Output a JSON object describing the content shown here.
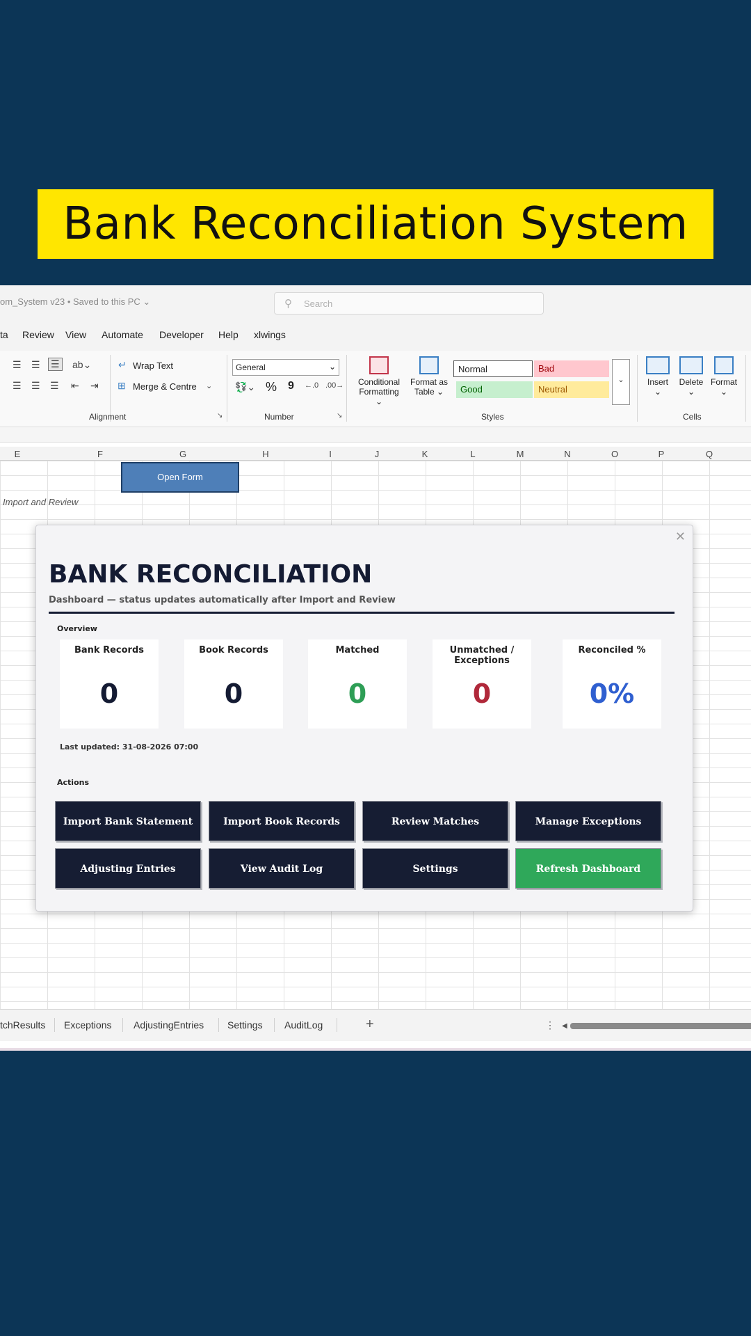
{
  "banner": {
    "title": "Bank Reconciliation System"
  },
  "excel": {
    "doc_title": "om_System v23 • Saved to this PC ⌄",
    "search_placeholder": "Search",
    "menu": [
      "ta",
      "Review",
      "View",
      "Automate",
      "Developer",
      "Help",
      "xlwings"
    ],
    "ribbon": {
      "wrap_text": "Wrap Text",
      "merge_centre": "Merge & Centre",
      "alignment_label": "Alignment",
      "number_format": "General",
      "number_label": "Number",
      "percent": "%",
      "comma": "9",
      "conditional_formatting_1": "Conditional",
      "conditional_formatting_2": "Formatting ⌄",
      "format_as_table_1": "Format as",
      "format_as_table_2": "Table ⌄",
      "styles": {
        "normal": "Normal",
        "bad": "Bad",
        "good": "Good",
        "neutral": "Neutral"
      },
      "styles_label": "Styles",
      "insert": "Insert",
      "delete": "Delete",
      "format": "Format",
      "cells_label": "Cells"
    },
    "columns": [
      "E",
      "F",
      "G",
      "H",
      "I",
      "J",
      "K",
      "L",
      "M",
      "N",
      "O",
      "P",
      "Q"
    ],
    "open_form": "Open Form",
    "import_note": "Import and Review",
    "sheet_tabs": [
      "tchResults",
      "Exceptions",
      "AdjustingEntries",
      "Settings",
      "AuditLog"
    ]
  },
  "dialog": {
    "title": "BANK RECONCILIATION",
    "subtitle": "Dashboard — status updates automatically after Import and Review",
    "overview_label": "Overview",
    "cards": [
      {
        "label": "Bank Records",
        "value": "0",
        "color": "#141b33"
      },
      {
        "label": "Book Records",
        "value": "0",
        "color": "#141b33"
      },
      {
        "label": "Matched",
        "value": "0",
        "color": "#2e9e56"
      },
      {
        "label": "Unmatched / Exceptions",
        "value": "0",
        "color": "#b0283a"
      },
      {
        "label": "Reconciled %",
        "value": "0%",
        "color": "#2f5fd0"
      }
    ],
    "last_updated": "Last updated: 31-08-2026 07:00",
    "actions_label": "Actions",
    "actions": [
      {
        "label": "Import Bank Statement",
        "color": "#161d33"
      },
      {
        "label": "Import Book Records",
        "color": "#161d33"
      },
      {
        "label": "Review Matches",
        "color": "#161d33"
      },
      {
        "label": "Manage Exceptions",
        "color": "#161d33"
      },
      {
        "label": "Adjusting Entries",
        "color": "#161d33"
      },
      {
        "label": "View Audit Log",
        "color": "#161d33"
      },
      {
        "label": "Settings",
        "color": "#161d33"
      },
      {
        "label": "Refresh Dashboard",
        "color": "#2fa85a"
      }
    ]
  }
}
